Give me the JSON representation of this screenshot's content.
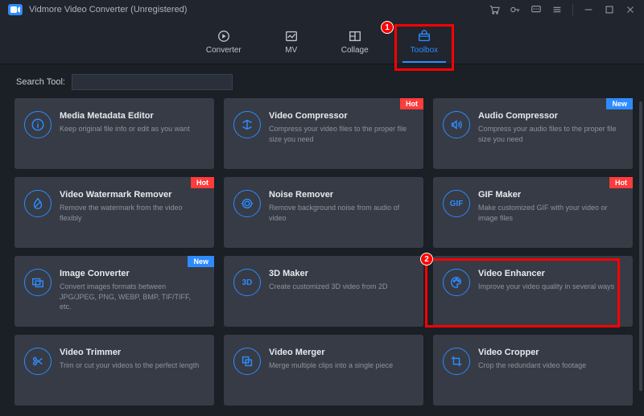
{
  "app": {
    "title": "Vidmore Video Converter (Unregistered)"
  },
  "nav": {
    "converter": "Converter",
    "mv": "MV",
    "collage": "Collage",
    "toolbox": "Toolbox"
  },
  "search": {
    "label": "Search Tool:",
    "value": ""
  },
  "badges": {
    "hot": "Hot",
    "new": "New"
  },
  "tools": {
    "meta": {
      "title": "Media Metadata Editor",
      "desc": "Keep original file info or edit as you want"
    },
    "vcomp": {
      "title": "Video Compressor",
      "desc": "Compress your video files to the proper file size you need"
    },
    "acomp": {
      "title": "Audio Compressor",
      "desc": "Compress your audio files to the proper file size you need"
    },
    "water": {
      "title": "Video Watermark Remover",
      "desc": "Remove the watermark from the video flexibly"
    },
    "noise": {
      "title": "Noise Remover",
      "desc": "Remove background noise from audio of video"
    },
    "gif": {
      "title": "GIF Maker",
      "desc": "Make customized GIF with your video or image files"
    },
    "imgc": {
      "title": "Image Converter",
      "desc": "Convert images formats between JPG/JPEG, PNG, WEBP, BMP, TIF/TIFF, etc."
    },
    "td": {
      "title": "3D Maker",
      "desc": "Create customized 3D video from 2D"
    },
    "venh": {
      "title": "Video Enhancer",
      "desc": "Improve your video quality in several ways"
    },
    "trim": {
      "title": "Video Trimmer",
      "desc": "Trim or cut your videos to the perfect length"
    },
    "merge": {
      "title": "Video Merger",
      "desc": "Merge multiple clips into a single piece"
    },
    "crop": {
      "title": "Video Cropper",
      "desc": "Crop the redundant video footage"
    }
  },
  "highlight": {
    "num1": "1",
    "num2": "2"
  }
}
